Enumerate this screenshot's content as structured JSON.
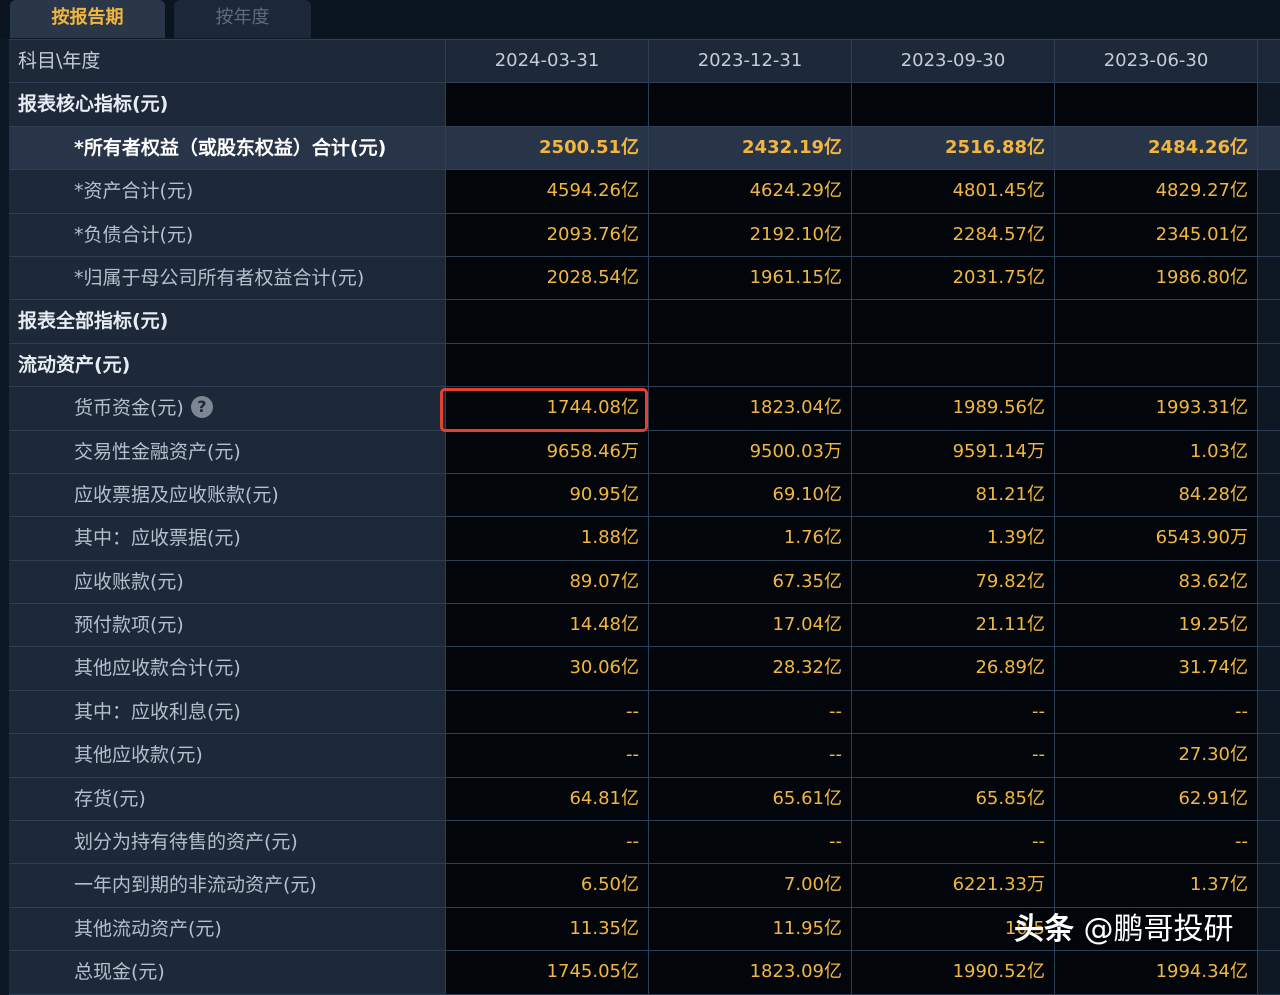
{
  "tabs": [
    {
      "label": "按报告期",
      "active": true
    },
    {
      "label": "按年度",
      "active": false
    }
  ],
  "header": {
    "label": "科目\\年度",
    "dates": [
      "2024-03-31",
      "2023-12-31",
      "2023-09-30",
      "2023-06-30"
    ]
  },
  "rows": [
    {
      "label": "报表核心指标(元)",
      "values": [
        "",
        "",
        "",
        ""
      ]
    },
    {
      "label": "*所有者权益（或股东权益）合计(元)",
      "values": [
        "2500.51亿",
        "2432.19亿",
        "2516.88亿",
        "2484.26亿"
      ]
    },
    {
      "label": "*资产合计(元)",
      "values": [
        "4594.26亿",
        "4624.29亿",
        "4801.45亿",
        "4829.27亿"
      ]
    },
    {
      "label": "*负债合计(元)",
      "values": [
        "2093.76亿",
        "2192.10亿",
        "2284.57亿",
        "2345.01亿"
      ]
    },
    {
      "label": "*归属于母公司所有者权益合计(元)",
      "values": [
        "2028.54亿",
        "1961.15亿",
        "2031.75亿",
        "1986.80亿"
      ]
    },
    {
      "label": "报表全部指标(元)",
      "values": [
        "",
        "",
        "",
        ""
      ]
    },
    {
      "label": "流动资产(元)",
      "values": [
        "",
        "",
        "",
        ""
      ]
    },
    {
      "label": "货币资金(元)",
      "values": [
        "1744.08亿",
        "1823.04亿",
        "1989.56亿",
        "1993.31亿"
      ],
      "help_icon": "?"
    },
    {
      "label": "交易性金融资产(元)",
      "values": [
        "9658.46万",
        "9500.03万",
        "9591.14万",
        "1.03亿"
      ]
    },
    {
      "label": "应收票据及应收账款(元)",
      "values": [
        "90.95亿",
        "69.10亿",
        "81.21亿",
        "84.28亿"
      ]
    },
    {
      "label": "其中：应收票据(元)",
      "values": [
        "1.88亿",
        "1.76亿",
        "1.39亿",
        "6543.90万"
      ]
    },
    {
      "label": "应收账款(元)",
      "values": [
        "89.07亿",
        "67.35亿",
        "79.82亿",
        "83.62亿"
      ]
    },
    {
      "label": "预付款项(元)",
      "values": [
        "14.48亿",
        "17.04亿",
        "21.11亿",
        "19.25亿"
      ]
    },
    {
      "label": "其他应收款合计(元)",
      "values": [
        "30.06亿",
        "28.32亿",
        "26.89亿",
        "31.74亿"
      ]
    },
    {
      "label": "其中：应收利息(元)",
      "values": [
        "--",
        "--",
        "--",
        "--"
      ]
    },
    {
      "label": "其他应收款(元)",
      "values": [
        "--",
        "--",
        "--",
        "27.30亿"
      ]
    },
    {
      "label": "存货(元)",
      "values": [
        "64.81亿",
        "65.61亿",
        "65.85亿",
        "62.91亿"
      ]
    },
    {
      "label": "划分为持有待售的资产(元)",
      "values": [
        "--",
        "--",
        "--",
        "--"
      ]
    },
    {
      "label": "一年内到期的非流动资产(元)",
      "values": [
        "6.50亿",
        "7.00亿",
        "6221.33万",
        "1.37亿"
      ]
    },
    {
      "label": "其他流动资产(元)",
      "values": [
        "11.35亿",
        "11.95亿",
        "10.5",
        ""
      ]
    },
    {
      "label": "总现金(元)",
      "values": [
        "1745.05亿",
        "1823.09亿",
        "1990.52亿",
        "1994.34亿"
      ]
    }
  ],
  "watermark": {
    "logo": "头条",
    "handle": "@鹏哥投研"
  },
  "colors": {
    "value": "#f2b640",
    "highlight_box": "#e2412f",
    "header_bg": "#1d2838",
    "cell_bg": "#02060a"
  }
}
